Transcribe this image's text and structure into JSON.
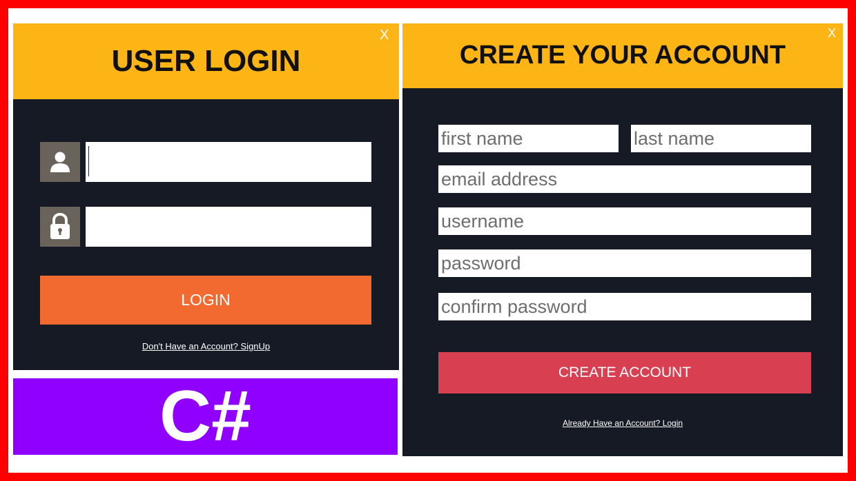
{
  "login": {
    "title": "USER LOGIN",
    "close": "X",
    "username_value": "",
    "password_value": "",
    "button_label": "LOGIN",
    "signup_link": "Don't Have an Account? SignUp"
  },
  "signup": {
    "title": "CREATE YOUR ACCOUNT",
    "close": "X",
    "first_name_placeholder": "first name",
    "last_name_placeholder": "last name",
    "email_placeholder": "email address",
    "username_placeholder": "username",
    "password_placeholder": "password",
    "confirm_password_placeholder": "confirm password",
    "button_label": "CREATE ACCOUNT",
    "login_link": "Already Have an Account? Login"
  },
  "banner": {
    "text": "C#"
  },
  "icons": {
    "user": "user-icon",
    "lock": "lock-icon"
  },
  "colors": {
    "frame": "#ff0000",
    "header": "#fcb515",
    "panel": "#151a24",
    "login_button": "#f26a30",
    "create_button": "#d84052",
    "banner": "#8f00ff"
  }
}
